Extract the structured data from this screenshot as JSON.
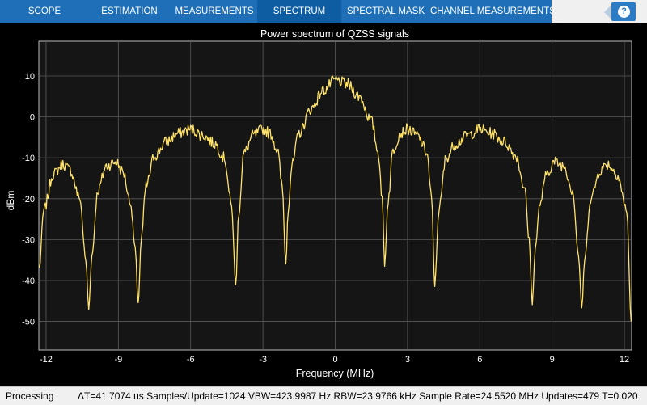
{
  "toolstrip": {
    "tabs": [
      {
        "label": "SCOPE",
        "active": false
      },
      {
        "label": "ESTIMATION",
        "active": false
      },
      {
        "label": "MEASUREMENTS",
        "active": false
      },
      {
        "label": "SPECTRUM",
        "active": true
      },
      {
        "label": "SPECTRAL MASK",
        "active": false
      },
      {
        "label": "CHANNEL MEASUREMENTS",
        "active": false
      }
    ],
    "help_label": "?"
  },
  "colors": {
    "toolstrip": "#1e6fb8",
    "active_tab": "#0e5da3",
    "plot_bg": "#000000",
    "axes_bg": "#151515",
    "trace": "#ffe26a"
  },
  "chart_data": {
    "type": "line",
    "title": "Power spectrum of QZSS signals",
    "xlabel": "Frequency (MHz)",
    "ylabel": "dBm",
    "xlim": [
      -12.3,
      12.3
    ],
    "ylim": [
      -57,
      18.5
    ],
    "xticks": [
      -12,
      -9,
      -6,
      -3,
      0,
      3,
      6,
      9,
      12
    ],
    "xtick_labels": [
      "-12",
      "-9",
      "-6",
      "-3",
      "0",
      "3",
      "6",
      "9",
      "12"
    ],
    "yticks": [
      10,
      0,
      -10,
      -20,
      -30,
      -40,
      -50
    ],
    "ytick_labels": [
      "10",
      "0",
      "-10",
      "-20",
      "-30",
      "-40",
      "-50"
    ],
    "grid": true,
    "series": [
      {
        "x": [
          -12.28,
          -12.1,
          -11.7,
          -11.3,
          -11,
          -10.6,
          -10.35,
          -10.23,
          -10.1,
          -9.85,
          -9.5,
          -9.1,
          -8.8,
          -8.5,
          -8.3,
          -8.18,
          -8.05,
          -7.85,
          -7.5,
          -7.0,
          -6.5,
          -6.0,
          -5.5,
          -5.0,
          -4.6,
          -4.3,
          -4.13,
          -4.0,
          -3.8,
          -3.4,
          -3.0,
          -2.7,
          -2.4,
          -2.2,
          -2.05,
          -1.95,
          -1.8,
          -1.5,
          -1.0,
          -0.5,
          0,
          0.5,
          1.0,
          1.5,
          1.8,
          1.95,
          2.05,
          2.2,
          2.4,
          2.7,
          3.0,
          3.4,
          3.8,
          4.0,
          4.13,
          4.3,
          4.6,
          5.0,
          5.5,
          6.0,
          6.5,
          7.0,
          7.5,
          7.85,
          8.05,
          8.18,
          8.3,
          8.5,
          8.8,
          9.1,
          9.5,
          9.85,
          10.1,
          10.23,
          10.35,
          10.6,
          11.0,
          11.3,
          11.7,
          12.1,
          12.28
        ],
        "y": [
          -37,
          -23,
          -14,
          -11.5,
          -13,
          -20,
          -35,
          -47,
          -34,
          -18,
          -12,
          -11,
          -13.5,
          -21,
          -32,
          -46,
          -30,
          -17,
          -9.5,
          -6,
          -4,
          -3,
          -4.5,
          -6.5,
          -10,
          -22,
          -41,
          -23,
          -9,
          -4.5,
          -3,
          -4,
          -8,
          -17,
          -36,
          -22,
          -12,
          -4,
          2,
          6.5,
          9,
          8,
          5,
          -1,
          -9,
          -20,
          -36,
          -20,
          -8,
          -4,
          -3,
          -4.5,
          -8.5,
          -20,
          -41,
          -23,
          -10,
          -6.5,
          -4.5,
          -3,
          -4,
          -6,
          -9.5,
          -17,
          -30,
          -46,
          -32,
          -21,
          -13.5,
          -11,
          -12,
          -18,
          -34,
          -47,
          -35,
          -20,
          -13,
          -11.5,
          -14,
          -23,
          -50
        ]
      }
    ]
  },
  "statusbar": {
    "state": "Processing",
    "measurements": "ΔT=41.7074 us  Samples/Update=1024  VBW=423.9987 Hz  RBW=23.9766 kHz  Sample Rate=24.5520 MHz  Updates=479  T=0.020"
  }
}
